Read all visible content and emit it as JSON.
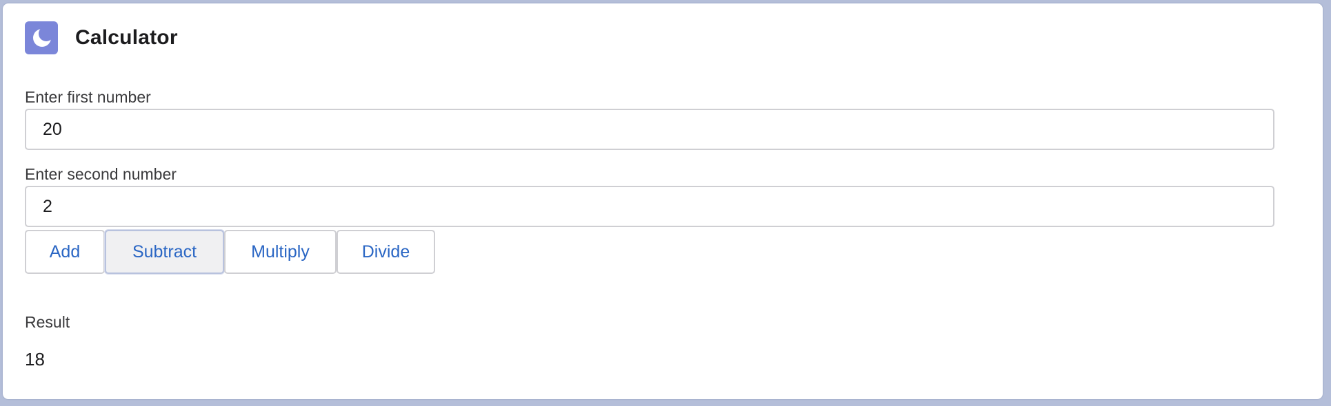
{
  "app": {
    "title": "Calculator",
    "icon": "moon-icon",
    "accent_color": "#7b86d9"
  },
  "form": {
    "first_label": "Enter first number",
    "first_value": "20",
    "second_label": "Enter second number",
    "second_value": "2"
  },
  "buttons": {
    "add": "Add",
    "subtract": "Subtract",
    "multiply": "Multiply",
    "divide": "Divide",
    "active": "subtract",
    "text_color": "#2a66c4"
  },
  "result": {
    "label": "Result",
    "value": "18"
  }
}
